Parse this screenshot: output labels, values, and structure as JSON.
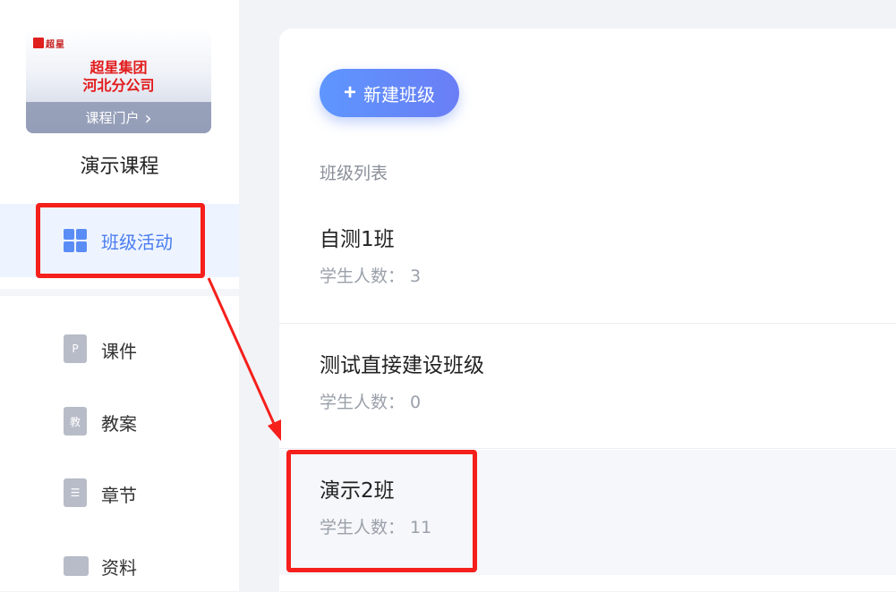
{
  "sidebar": {
    "cover": {
      "logo_text": "超星",
      "title_line1": "超星集团",
      "title_line2": "河北分公司",
      "portal_label": "课程门户",
      "portal_arrow": "›"
    },
    "course_name": "演示课程",
    "active_item": {
      "label": "班级活动",
      "icon": "grid-icon"
    },
    "items": [
      {
        "label": "课件",
        "icon": "ppt-file-icon",
        "glyph": "P"
      },
      {
        "label": "教案",
        "icon": "lesson-plan-icon",
        "glyph": "教"
      },
      {
        "label": "章节",
        "icon": "list-icon",
        "glyph": "☰"
      },
      {
        "label": "资料",
        "icon": "folder-icon",
        "glyph": ""
      }
    ]
  },
  "main": {
    "new_class_button": "新建班级",
    "list_title": "班级列表",
    "count_label": "学生人数：",
    "classes": [
      {
        "name": "自测1班",
        "count": "3"
      },
      {
        "name": "测试直接建设班级",
        "count": "0"
      },
      {
        "name": "演示2班",
        "count": "11"
      }
    ]
  },
  "colors": {
    "accent": "#4a7cf0",
    "annotation_red": "#f5201c",
    "button_gradient_start": "#5e96ff",
    "button_gradient_end": "#6a7ef5"
  }
}
